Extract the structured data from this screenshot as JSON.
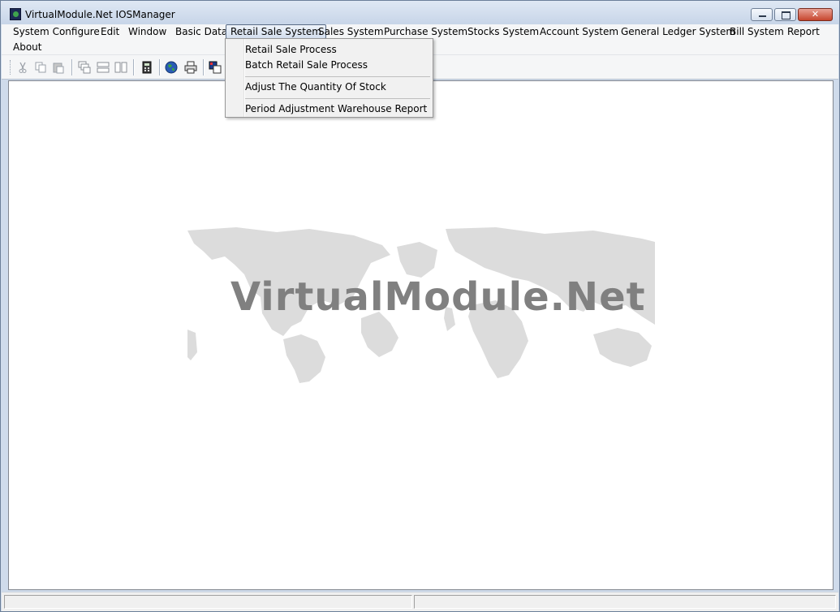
{
  "window": {
    "title": "VirtualModule.Net IOSManager",
    "close_symbol": "✕",
    "icon": "app-globe-icon"
  },
  "menubar": {
    "items": [
      {
        "label": "System Configure"
      },
      {
        "label": "Edit"
      },
      {
        "label": "Window"
      },
      {
        "label": "Basic Data"
      },
      {
        "label": "Retail Sale System",
        "open": true
      },
      {
        "label": "Sales System"
      },
      {
        "label": "Purchase System"
      },
      {
        "label": "Stocks System"
      },
      {
        "label": "Account System"
      },
      {
        "label": "General Ledger System"
      },
      {
        "label": "Bill System"
      },
      {
        "label": "Report"
      },
      {
        "label": "About"
      }
    ]
  },
  "dropdown": {
    "items": [
      {
        "label": "Retail Sale Process"
      },
      {
        "label": "Batch Retail Sale Process"
      },
      {
        "label": "Adjust The Quantity Of Stock"
      },
      {
        "label": "Period Adjustment Warehouse Report"
      }
    ]
  },
  "toolbar": {
    "icons": [
      "cut-icon",
      "copy-icon",
      "paste-icon",
      "cascade-icon",
      "tile-horizontal-icon",
      "tile-vertical-icon",
      "calculator-icon",
      "globe-icon",
      "print-icon",
      "report-icon"
    ]
  },
  "workspace": {
    "watermark_text": "VirtualModule.Net"
  },
  "colors": {
    "accent": "#5a6c86",
    "close_button": "#c6452d",
    "watermark": "#808080",
    "map": "#dcdcdc"
  }
}
